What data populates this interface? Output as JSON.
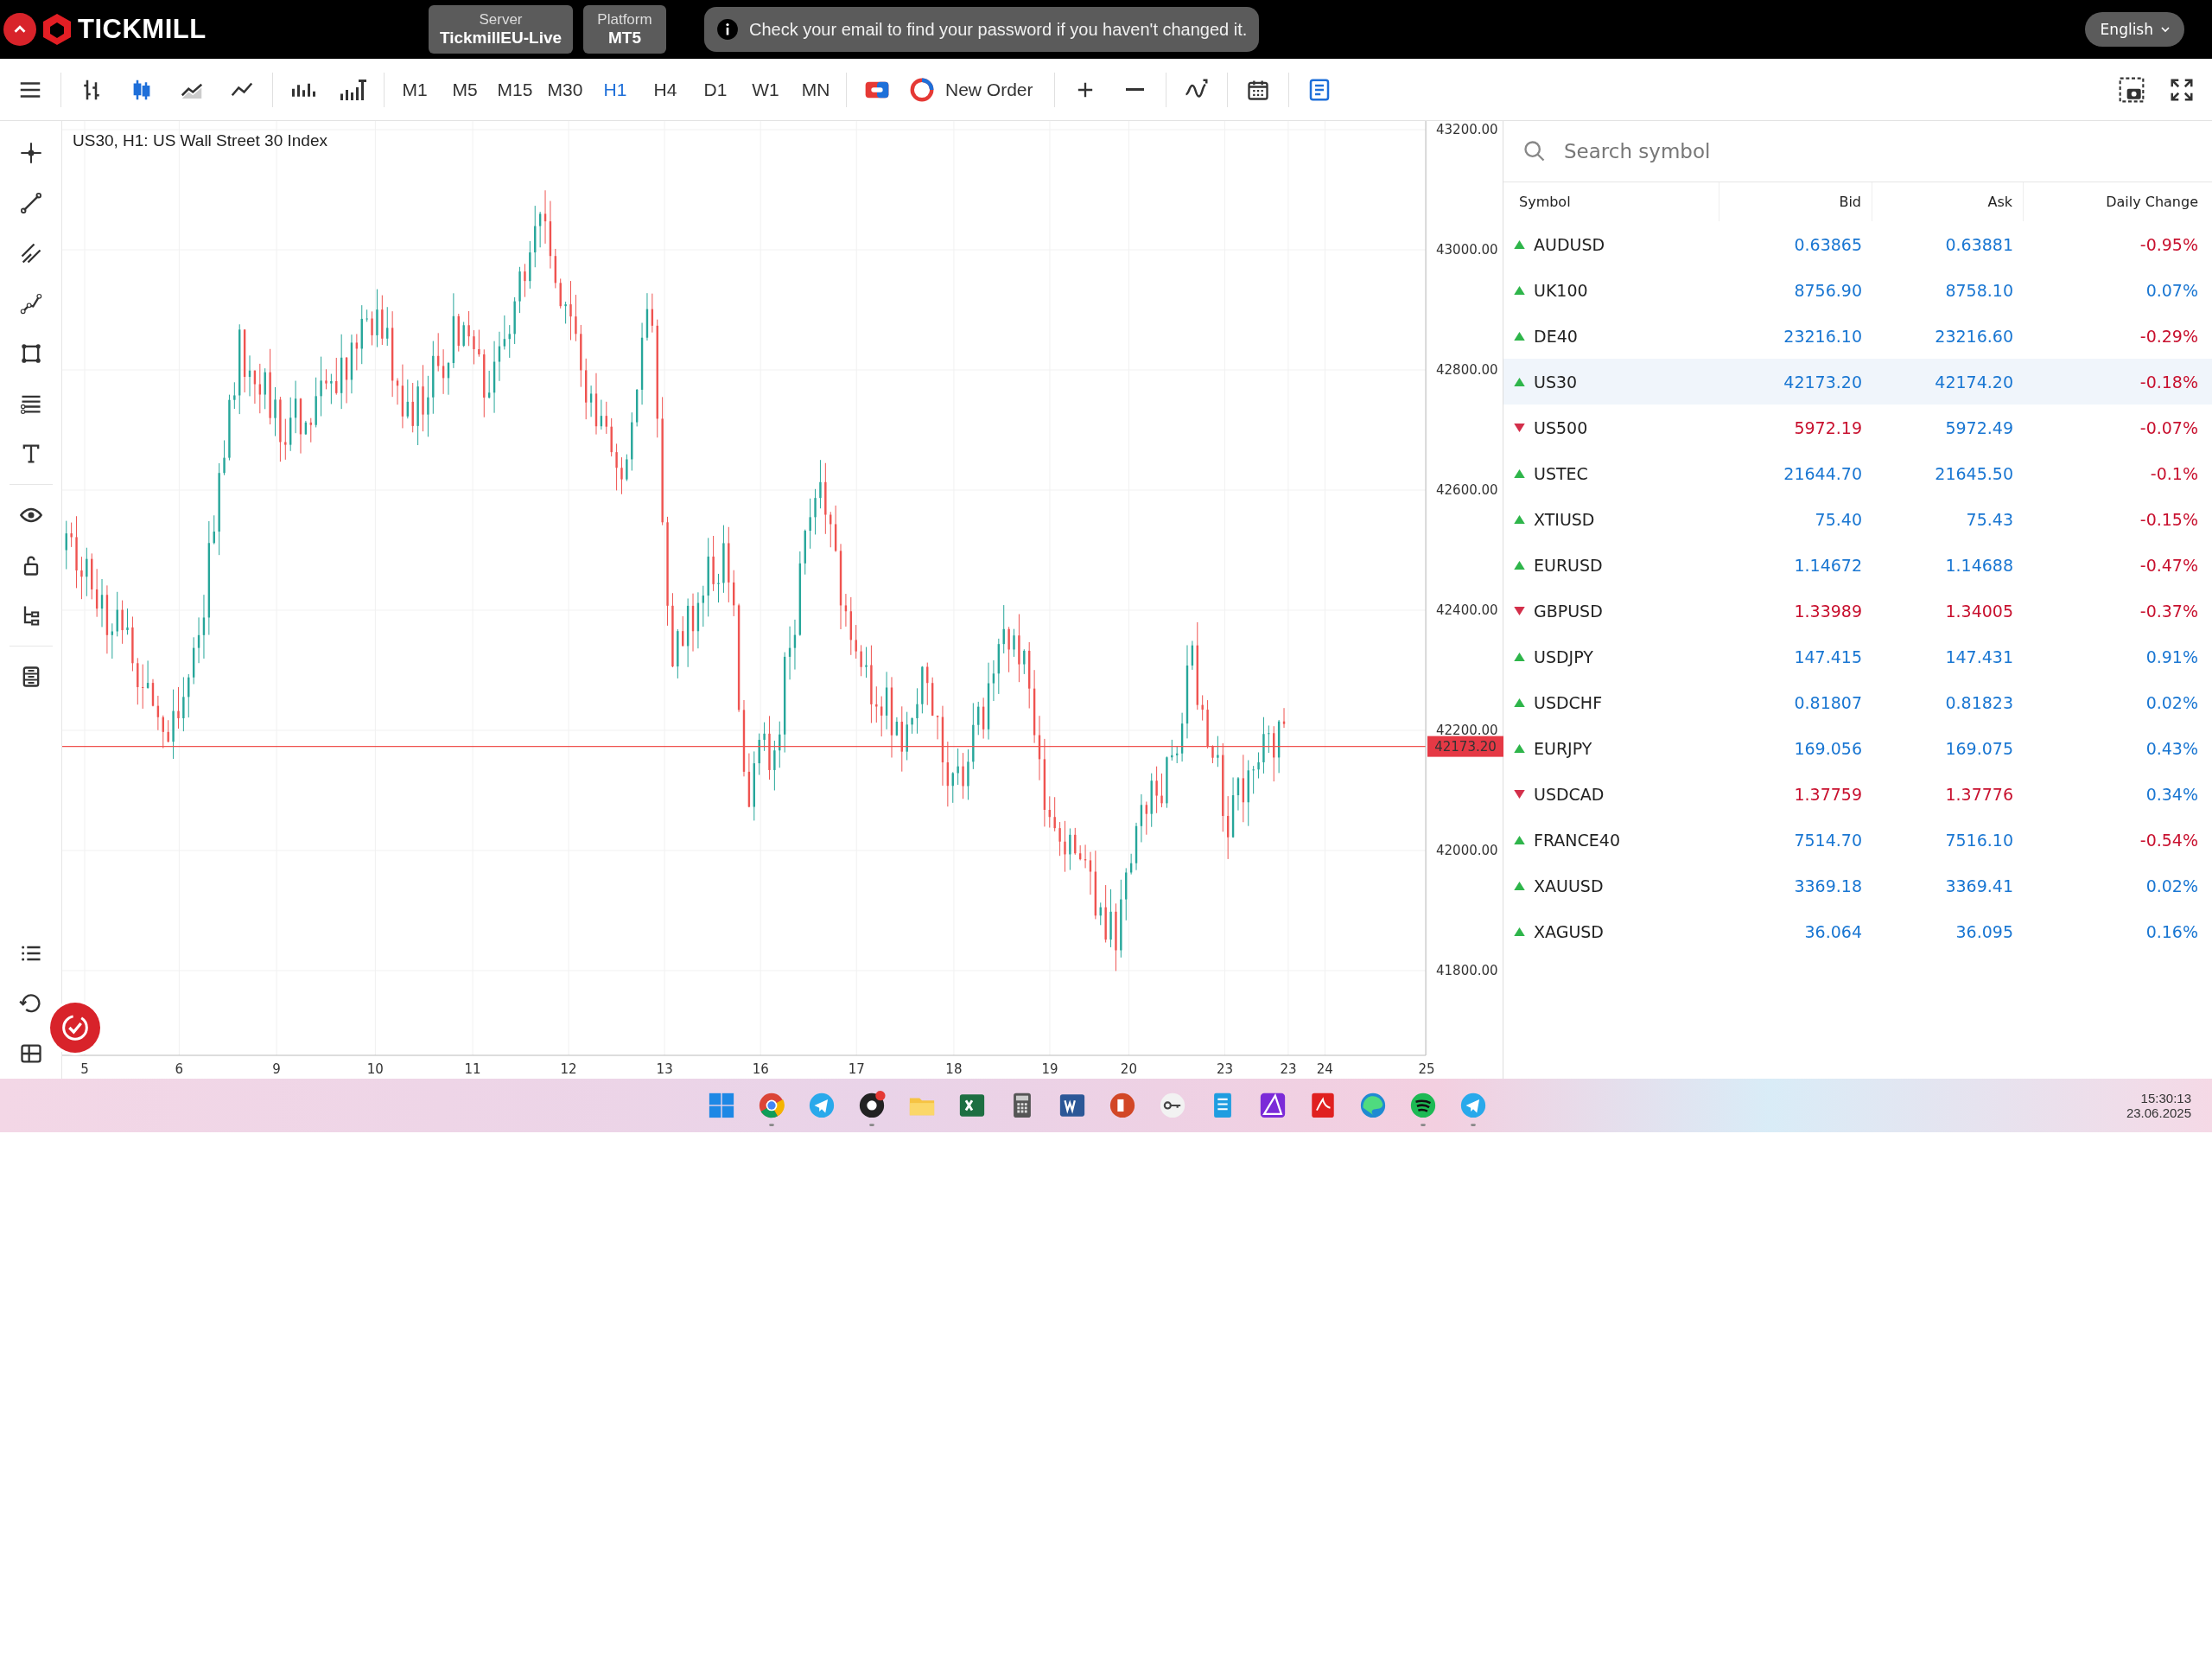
{
  "top_bar": {
    "logo": "TICKMILL",
    "server": {
      "label": "Server",
      "value": "TickmillEU-Live"
    },
    "platform": {
      "label": "Platform",
      "value": "MT5"
    },
    "notice": "Check your email to find your password if you haven't changed it.",
    "language": "English"
  },
  "toolbar": {
    "chart_types": [
      {
        "kind": "bars",
        "selected": false
      },
      {
        "kind": "candles",
        "selected": true
      },
      {
        "kind": "area",
        "selected": false
      },
      {
        "kind": "line",
        "selected": false
      }
    ],
    "timeframes": [
      {
        "label": "M1",
        "selected": false
      },
      {
        "label": "M5",
        "selected": false
      },
      {
        "label": "M15",
        "selected": false
      },
      {
        "label": "M30",
        "selected": false
      },
      {
        "label": "H1",
        "selected": true
      },
      {
        "label": "H4",
        "selected": false
      },
      {
        "label": "D1",
        "selected": false
      },
      {
        "label": "W1",
        "selected": false
      },
      {
        "label": "MN",
        "selected": false
      }
    ],
    "new_order": "New Order"
  },
  "chart": {
    "title": "US30, H1: US Wall Street 30 Index",
    "y_ticks": [
      "43200.00",
      "43000.00",
      "42800.00",
      "42600.00",
      "42400.00",
      "42200.00",
      "42000.00",
      "41800.00"
    ],
    "x_ticks": [
      "5",
      "6",
      "9",
      "10",
      "11",
      "12",
      "13",
      "16",
      "17",
      "18",
      "19",
      "20",
      "23",
      "23",
      "24",
      "25"
    ],
    "last_price": "42173.20"
  },
  "watchlist": {
    "search_placeholder": "Search symbol",
    "columns": [
      "Symbol",
      "Bid",
      "Ask",
      "Daily Change"
    ],
    "rows": [
      {
        "symbol": "AUDUSD",
        "up": true,
        "bid": "0.63865",
        "bid_up": true,
        "ask": "0.63881",
        "ask_up": true,
        "change": "-0.95%",
        "change_up": false,
        "selected": false
      },
      {
        "symbol": "UK100",
        "up": true,
        "bid": "8756.90",
        "bid_up": true,
        "ask": "8758.10",
        "ask_up": true,
        "change": "0.07%",
        "change_up": true,
        "selected": false
      },
      {
        "symbol": "DE40",
        "up": true,
        "bid": "23216.10",
        "bid_up": true,
        "ask": "23216.60",
        "ask_up": true,
        "change": "-0.29%",
        "change_up": false,
        "selected": false
      },
      {
        "symbol": "US30",
        "up": true,
        "bid": "42173.20",
        "bid_up": true,
        "ask": "42174.20",
        "ask_up": true,
        "change": "-0.18%",
        "change_up": false,
        "selected": true
      },
      {
        "symbol": "US500",
        "up": false,
        "bid": "5972.19",
        "bid_up": false,
        "ask": "5972.49",
        "ask_up": true,
        "change": "-0.07%",
        "change_up": false,
        "selected": false
      },
      {
        "symbol": "USTEC",
        "up": true,
        "bid": "21644.70",
        "bid_up": true,
        "ask": "21645.50",
        "ask_up": true,
        "change": "-0.1%",
        "change_up": false,
        "selected": false
      },
      {
        "symbol": "XTIUSD",
        "up": true,
        "bid": "75.40",
        "bid_up": true,
        "ask": "75.43",
        "ask_up": true,
        "change": "-0.15%",
        "change_up": false,
        "selected": false
      },
      {
        "symbol": "EURUSD",
        "up": true,
        "bid": "1.14672",
        "bid_up": true,
        "ask": "1.14688",
        "ask_up": true,
        "change": "-0.47%",
        "change_up": false,
        "selected": false
      },
      {
        "symbol": "GBPUSD",
        "up": false,
        "bid": "1.33989",
        "bid_up": false,
        "ask": "1.34005",
        "ask_up": false,
        "change": "-0.37%",
        "change_up": false,
        "selected": false
      },
      {
        "symbol": "USDJPY",
        "up": true,
        "bid": "147.415",
        "bid_up": true,
        "ask": "147.431",
        "ask_up": true,
        "change": "0.91%",
        "change_up": true,
        "selected": false
      },
      {
        "symbol": "USDCHF",
        "up": true,
        "bid": "0.81807",
        "bid_up": true,
        "ask": "0.81823",
        "ask_up": true,
        "change": "0.02%",
        "change_up": true,
        "selected": false
      },
      {
        "symbol": "EURJPY",
        "up": true,
        "bid": "169.056",
        "bid_up": true,
        "ask": "169.075",
        "ask_up": true,
        "change": "0.43%",
        "change_up": true,
        "selected": false
      },
      {
        "symbol": "USDCAD",
        "up": false,
        "bid": "1.37759",
        "bid_up": false,
        "ask": "1.37776",
        "ask_up": false,
        "change": "0.34%",
        "change_up": true,
        "selected": false
      },
      {
        "symbol": "FRANCE40",
        "up": true,
        "bid": "7514.70",
        "bid_up": true,
        "ask": "7516.10",
        "ask_up": true,
        "change": "-0.54%",
        "change_up": false,
        "selected": false
      },
      {
        "symbol": "XAUUSD",
        "up": true,
        "bid": "3369.18",
        "bid_up": true,
        "ask": "3369.41",
        "ask_up": true,
        "change": "0.02%",
        "change_up": true,
        "selected": false
      },
      {
        "symbol": "XAGUSD",
        "up": true,
        "bid": "36.064",
        "bid_up": true,
        "ask": "36.095",
        "ask_up": true,
        "change": "0.16%",
        "change_up": true,
        "selected": false
      }
    ]
  },
  "taskbar": {
    "apps": [
      {
        "kind": "start",
        "running": false
      },
      {
        "kind": "browser",
        "running": true
      },
      {
        "kind": "messenger",
        "running": false
      },
      {
        "kind": "recorder",
        "running": true
      },
      {
        "kind": "folder",
        "running": false
      },
      {
        "kind": "spreadsheet",
        "running": false
      },
      {
        "kind": "calculator",
        "running": false
      },
      {
        "kind": "document",
        "running": false
      },
      {
        "kind": "presentation",
        "running": false
      },
      {
        "kind": "key",
        "running": false
      },
      {
        "kind": "notepad",
        "running": false
      },
      {
        "kind": "vector",
        "running": false
      },
      {
        "kind": "pdf",
        "running": false
      },
      {
        "kind": "edge",
        "running": false
      },
      {
        "kind": "music",
        "running": true
      },
      {
        "kind": "messenger",
        "running": true
      }
    ],
    "time": "15:30:13",
    "date": "23.06.2025"
  }
}
